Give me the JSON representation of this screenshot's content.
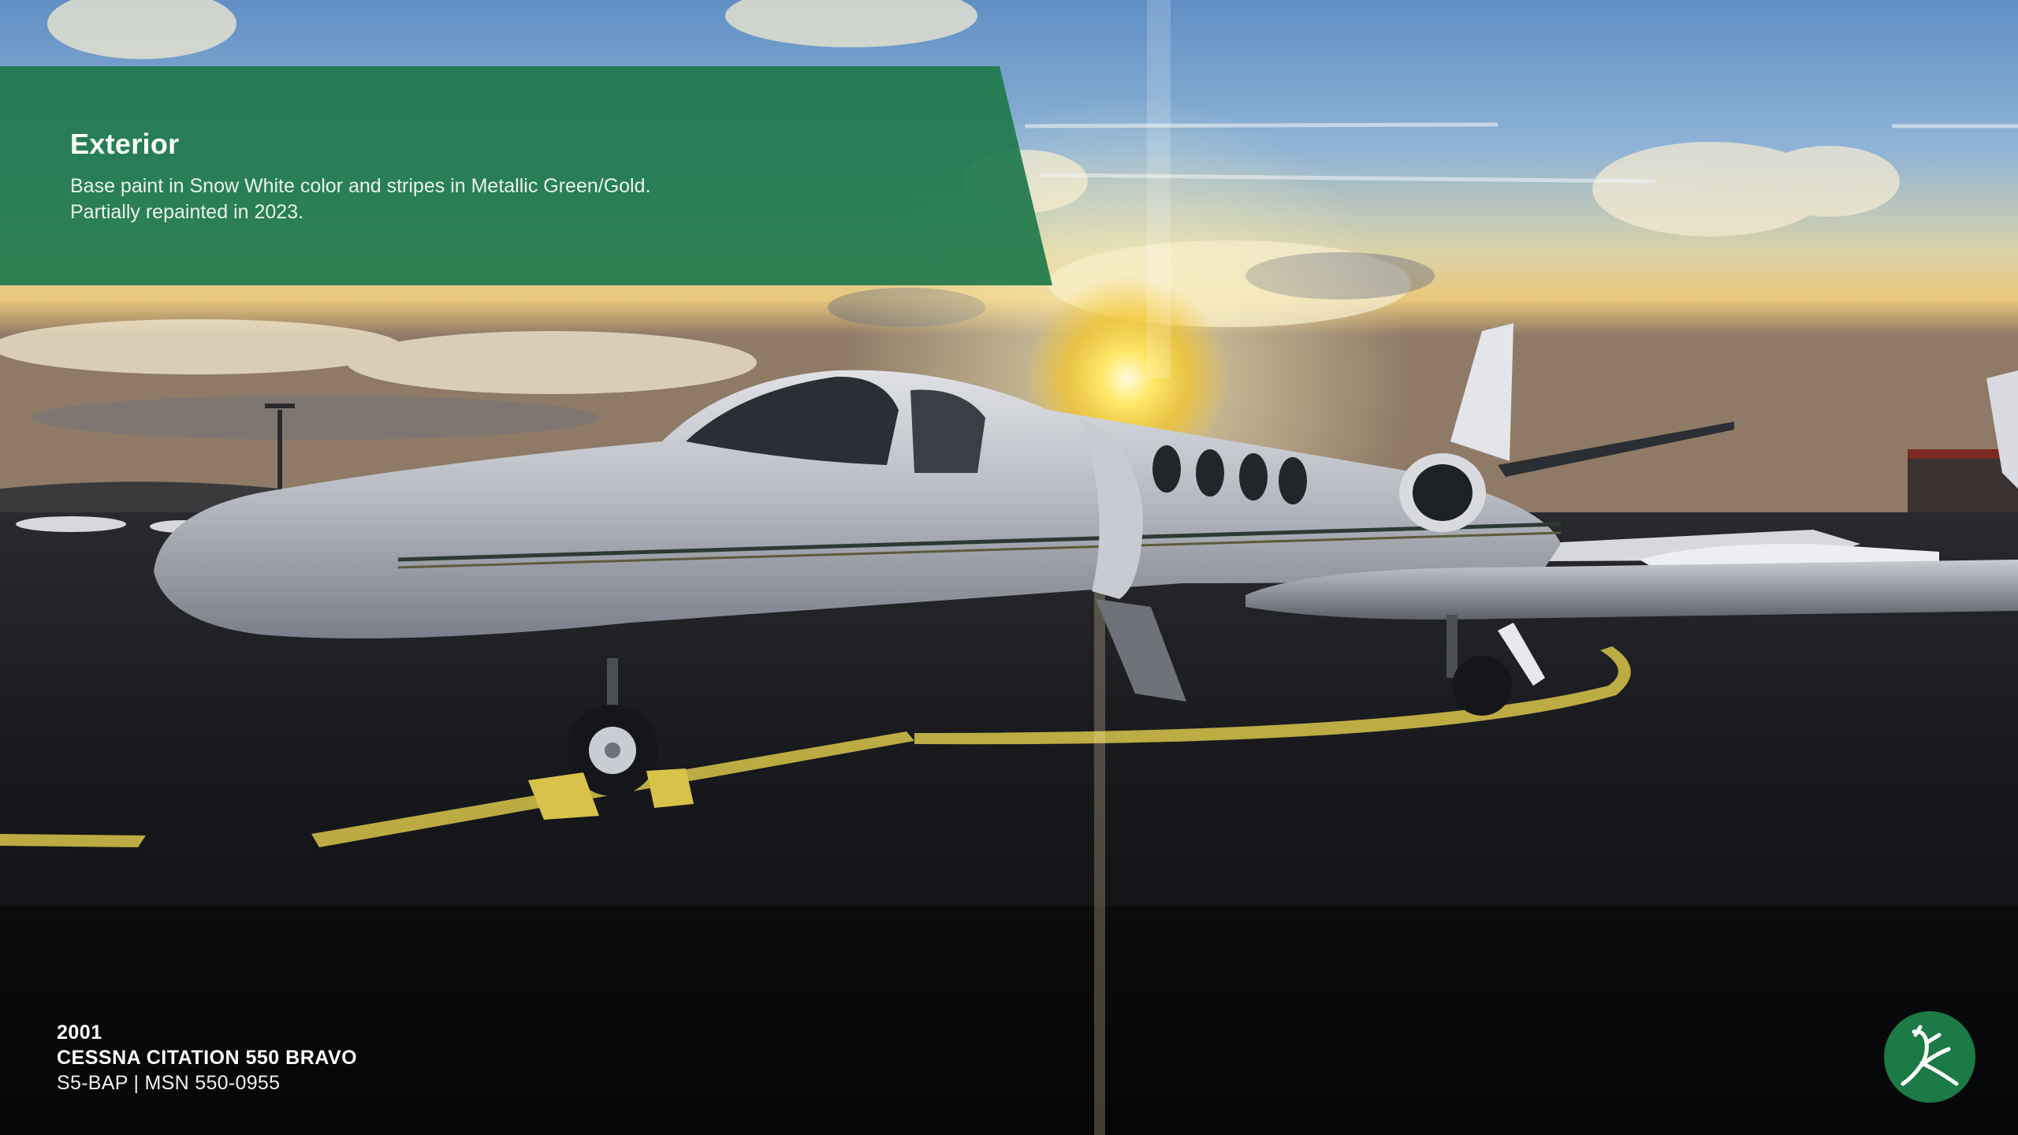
{
  "panel": {
    "title": "Exterior",
    "lines": [
      "Base paint in Snow White color and stripes in Metallic Green/Gold.",
      "Partially repainted in 2023."
    ]
  },
  "aircraft": {
    "year": "2001",
    "model": "CESSNA CITATION 550 BRAVO",
    "registration": "S5-BAP | MSN 550-0955"
  },
  "logo": {
    "icon": "bird-logo-icon"
  },
  "colors": {
    "panel_green": "#1f7a4a",
    "logo_green": "#1b7a45",
    "text": "#ffffff"
  }
}
